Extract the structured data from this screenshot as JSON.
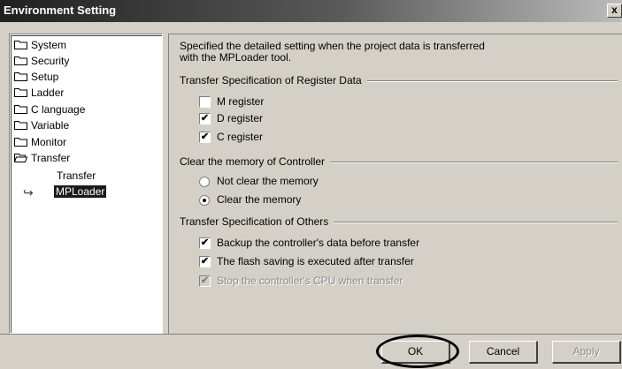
{
  "window": {
    "title": "Environment Setting",
    "close_label": "x"
  },
  "tree": {
    "items": [
      {
        "label": "System"
      },
      {
        "label": "Security"
      },
      {
        "label": "Setup"
      },
      {
        "label": "Ladder"
      },
      {
        "label": "C language"
      },
      {
        "label": "Variable"
      },
      {
        "label": "Monitor"
      },
      {
        "label": "Transfer"
      }
    ],
    "children": [
      {
        "label": "Transfer"
      },
      {
        "label": "MPLoader",
        "selected": true
      }
    ]
  },
  "panel": {
    "description_line1": "Specified the detailed setting when the project data is transferred",
    "description_line2": "with the MPLoader tool.",
    "group_register": {
      "title": "Transfer Specification of Register Data",
      "options": [
        {
          "label": "M register",
          "checked": false
        },
        {
          "label": "D register",
          "checked": true
        },
        {
          "label": "C register",
          "checked": true
        }
      ]
    },
    "group_memory": {
      "title": "Clear the memory of Controller",
      "options": [
        {
          "label": "Not clear the memory",
          "selected": false
        },
        {
          "label": "Clear the memory",
          "selected": true
        }
      ]
    },
    "group_others": {
      "title": "Transfer Specification of Others",
      "options": [
        {
          "label": "Backup the controller's data before transfer",
          "checked": true,
          "enabled": true
        },
        {
          "label": "The flash saving is executed after transfer",
          "checked": true,
          "enabled": true
        },
        {
          "label": "Stop the controller's CPU when transfer",
          "checked": true,
          "enabled": false
        }
      ]
    }
  },
  "buttons": {
    "ok": "OK",
    "cancel": "Cancel",
    "apply": "Apply"
  },
  "icons": {
    "check": "✔"
  }
}
